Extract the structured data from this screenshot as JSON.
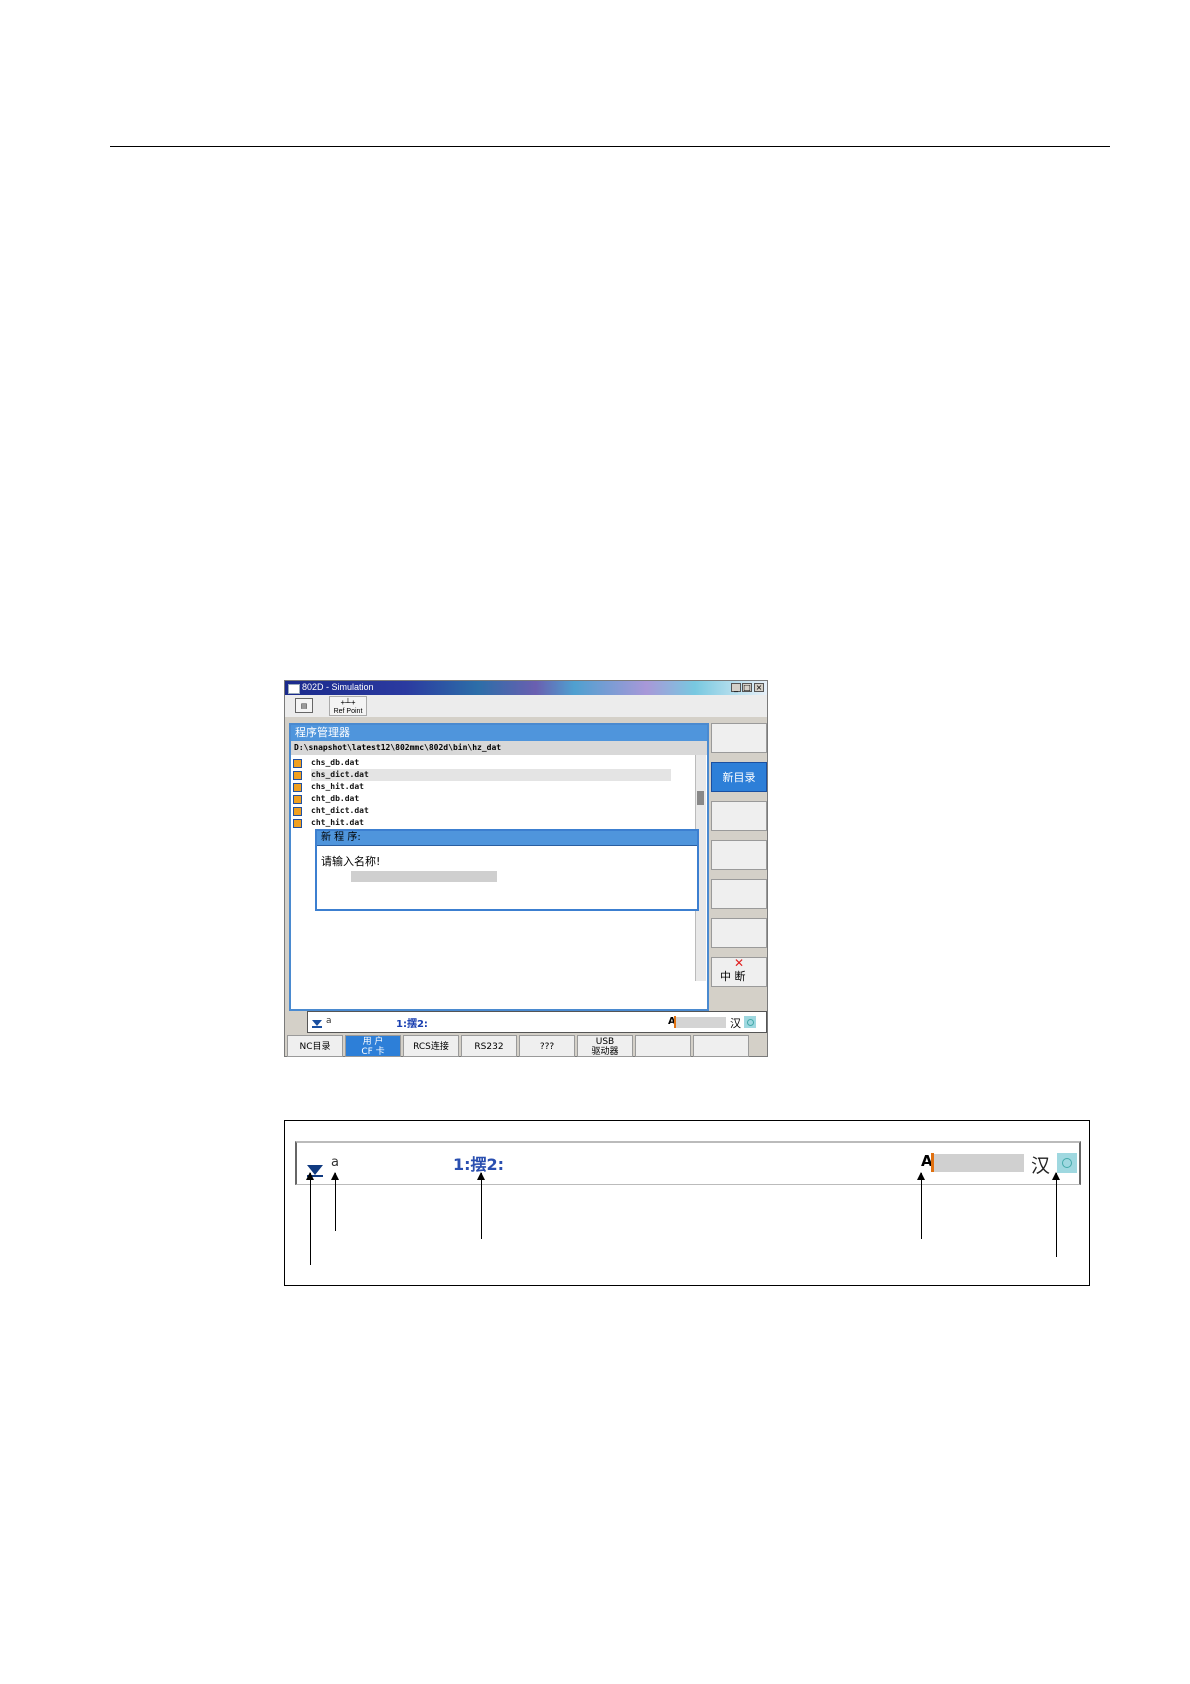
{
  "window": {
    "title": "802D - Simulation",
    "toolbar_ref_point": "Ref Point"
  },
  "panel": {
    "title": "程序管理器",
    "path": "D:\\snapshot\\latest12\\802mmc\\802d\\bin\\hz_dat",
    "files": [
      "chs_db.dat",
      "chs_dict.dat",
      "chs_hit.dat",
      "cht_db.dat",
      "cht_dict.dat",
      "cht_hit.dat"
    ]
  },
  "dialog": {
    "title": "新 程 序:",
    "prompt": "请输入名称!"
  },
  "softkeys": {
    "new_dir": "新目录",
    "cancel": "中 断"
  },
  "hkeys": [
    "NC目录",
    "用 户\nCF 卡",
    "RCS连接",
    "RS232",
    "???",
    "USB\n驱动器"
  ],
  "status": {
    "mode": "a",
    "candidates": "1:摆2:",
    "caps": "A",
    "han": "汉"
  }
}
